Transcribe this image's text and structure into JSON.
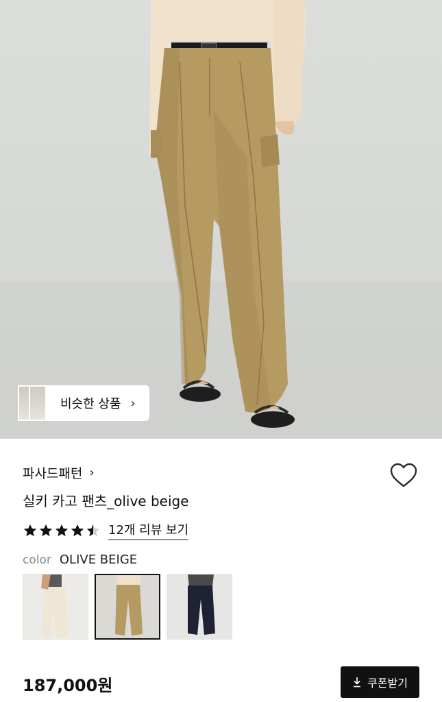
{
  "similar_products": {
    "label": "비슷한 상품",
    "chevron": "chevron-right-icon"
  },
  "product": {
    "brand": "파사드패턴",
    "title": "실키 카고 팬츠_olive beige",
    "rating": 4.5,
    "review_link": "12개 리뷰 보기",
    "color_label": "color",
    "color_value": "OLIVE BEIGE",
    "price": "187,000원",
    "wishlist_icon": "heart-icon"
  },
  "swatches": [
    {
      "name": "beige",
      "selected": false
    },
    {
      "name": "olive beige",
      "selected": true
    },
    {
      "name": "navy",
      "selected": false
    }
  ],
  "coupon_button": {
    "label": "쿠폰받기",
    "icon": "download-icon"
  },
  "colors": {
    "accent": "#111111",
    "pants": "#b59a62",
    "background": "#ffffff"
  }
}
